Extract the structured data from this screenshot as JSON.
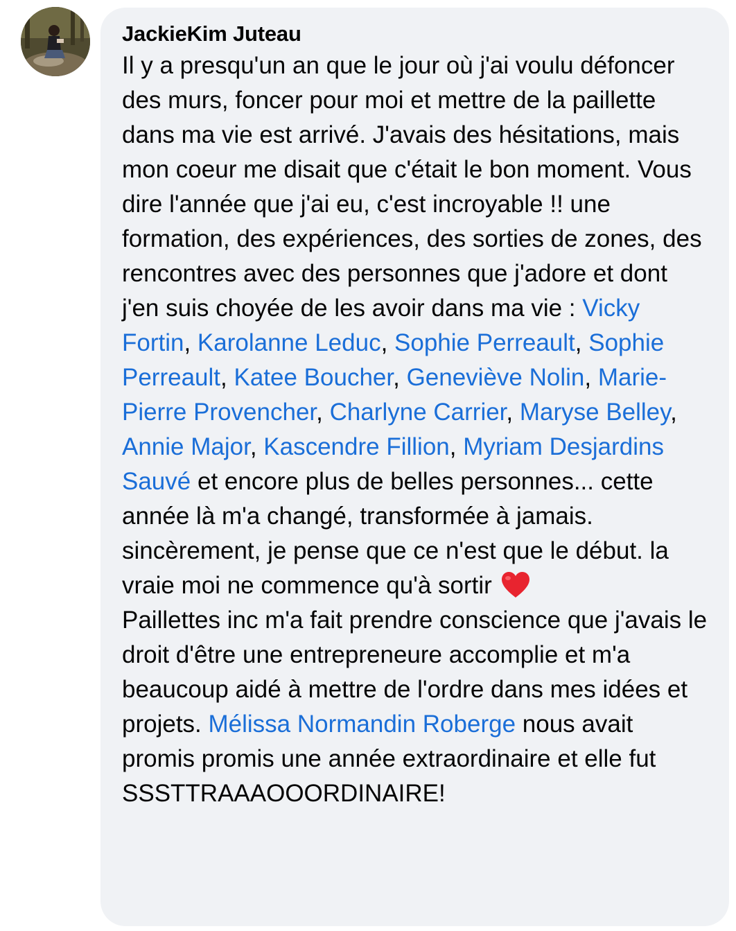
{
  "comment": {
    "author": "JackieKim Juteau",
    "avatar_icon": "profile-photo-avatar",
    "segments": [
      {
        "type": "text",
        "text": "Il y a presqu'un an que le jour où j'ai voulu défoncer des murs, foncer pour moi et mettre de la paillette dans ma vie est arrivé. J'avais des hésitations, mais mon coeur me disait que c'était le bon moment. Vous dire l'année que j'ai eu, c'est incroyable !! une formation, des expériences, des sorties de zones, des rencontres avec des personnes que j'adore et dont j'en suis choyée de les avoir dans ma vie : "
      },
      {
        "type": "mention",
        "text": "Vicky Fortin"
      },
      {
        "type": "text",
        "text": ", "
      },
      {
        "type": "mention",
        "text": "Karolanne Leduc"
      },
      {
        "type": "text",
        "text": ", "
      },
      {
        "type": "mention",
        "text": "Sophie Perreault"
      },
      {
        "type": "text",
        "text": ", "
      },
      {
        "type": "mention",
        "text": "Sophie Perreault"
      },
      {
        "type": "text",
        "text": ", "
      },
      {
        "type": "mention",
        "text": "Katee Boucher"
      },
      {
        "type": "text",
        "text": ", "
      },
      {
        "type": "mention",
        "text": "Geneviève Nolin"
      },
      {
        "type": "text",
        "text": ", "
      },
      {
        "type": "mention",
        "text": "Marie-Pierre Provencher"
      },
      {
        "type": "text",
        "text": ", "
      },
      {
        "type": "mention",
        "text": "Charlyne Carrier"
      },
      {
        "type": "text",
        "text": ", "
      },
      {
        "type": "mention",
        "text": "Maryse Belley"
      },
      {
        "type": "text",
        "text": ", "
      },
      {
        "type": "mention",
        "text": "Annie Major"
      },
      {
        "type": "text",
        "text": ", "
      },
      {
        "type": "mention",
        "text": "Kascendre Fillion"
      },
      {
        "type": "text",
        "text": ", "
      },
      {
        "type": "mention",
        "text": "Myriam Desjardins Sauvé"
      },
      {
        "type": "text",
        "text": " et encore plus de belles personnes... cette année là m'a changé, transformée à jamais. sincèrement, je pense que ce n'est que le début. la vraie moi ne commence qu'à sortir "
      },
      {
        "type": "emoji",
        "icon": "red-heart-icon"
      },
      {
        "type": "text",
        "text": "\nPaillettes inc m'a fait prendre conscience que j'avais le droit d'être une entrepreneure accomplie et m'a beaucoup aidé à mettre de l'ordre dans mes idées et projets. "
      },
      {
        "type": "mention",
        "text": "Mélissa Normandin Roberge"
      },
      {
        "type": "text",
        "text": " nous avait promis promis une année extraordinaire et elle fut SSSTTRAAAOOORDINAIRE!"
      }
    ]
  },
  "colors": {
    "bubble_bg": "#f0f2f5",
    "text": "#050505",
    "mention": "#1a6ed8",
    "heart": "#e8242f"
  }
}
